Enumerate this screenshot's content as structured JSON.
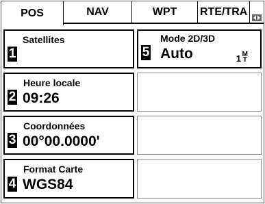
{
  "tabs": [
    {
      "label": "POS",
      "active": true
    },
    {
      "label": "NAV",
      "active": false
    },
    {
      "label": "WPT",
      "active": false
    },
    {
      "label": "RTE/TRA",
      "active": false
    }
  ],
  "cells": {
    "c1": {
      "number": "1",
      "label": "Satellites",
      "value": ""
    },
    "c2": {
      "number": "2",
      "label": "Heure locale",
      "value": "09:26"
    },
    "c3": {
      "number": "3",
      "label": "Coordonnées",
      "value": "00°00.0000'"
    },
    "c4": {
      "number": "4",
      "label": "Format Carte",
      "value": "WGS84"
    },
    "c5": {
      "number": "5",
      "label": "Mode 2D/3D",
      "value": "Auto",
      "unit_top": "M",
      "unit_bottom": "T",
      "unit_num": "1"
    }
  },
  "colors": {
    "background": "#ffffff",
    "foreground": "#000000"
  }
}
